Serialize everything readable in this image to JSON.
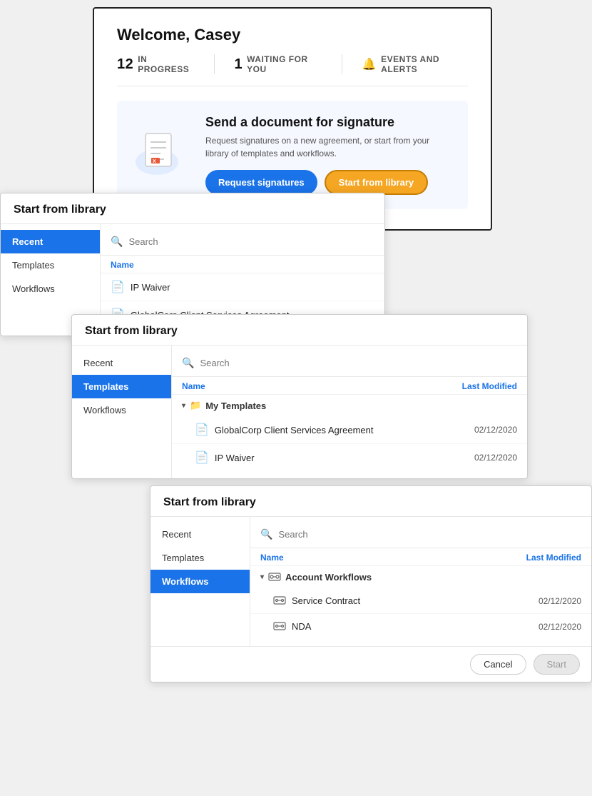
{
  "dashboard": {
    "title": "Welcome, Casey",
    "stats": [
      {
        "num": "12",
        "label": "IN PROGRESS"
      },
      {
        "num": "1",
        "label": "WAITING FOR YOU"
      },
      {
        "num": "",
        "label": "EVENTS AND ALERTS",
        "icon": "bell"
      }
    ],
    "send_section": {
      "heading": "Send a document for signature",
      "description": "Request signatures on a new agreement, or start from your library of templates and workflows.",
      "btn_request": "Request signatures",
      "btn_library": "Start from library"
    }
  },
  "panel1": {
    "title": "Start from library",
    "nav": [
      "Recent",
      "Templates",
      "Workflows"
    ],
    "active_nav": "Recent",
    "search_placeholder": "Search",
    "col_name": "Name",
    "items": [
      {
        "name": "IP Waiver"
      },
      {
        "name": "GlobalCorp Client Services Agreement"
      }
    ]
  },
  "panel2": {
    "title": "Start from library",
    "nav": [
      "Recent",
      "Templates",
      "Workflows"
    ],
    "active_nav": "Templates",
    "search_placeholder": "Search",
    "col_name": "Name",
    "col_modified": "Last Modified",
    "folder": "My Templates",
    "items": [
      {
        "name": "GlobalCorp Client Services Agreement",
        "date": "02/12/2020"
      },
      {
        "name": "IP Waiver",
        "date": "02/12/2020"
      }
    ]
  },
  "panel3": {
    "title": "Start from library",
    "nav": [
      "Recent",
      "Templates",
      "Workflows"
    ],
    "active_nav": "Workflows",
    "search_placeholder": "Search",
    "col_name": "Name",
    "col_modified": "Last Modified",
    "folder": "Account Workflows",
    "items": [
      {
        "name": "Service Contract",
        "date": "02/12/2020"
      },
      {
        "name": "NDA",
        "date": "02/12/2020"
      }
    ],
    "btn_cancel": "Cancel",
    "btn_start": "Start"
  }
}
